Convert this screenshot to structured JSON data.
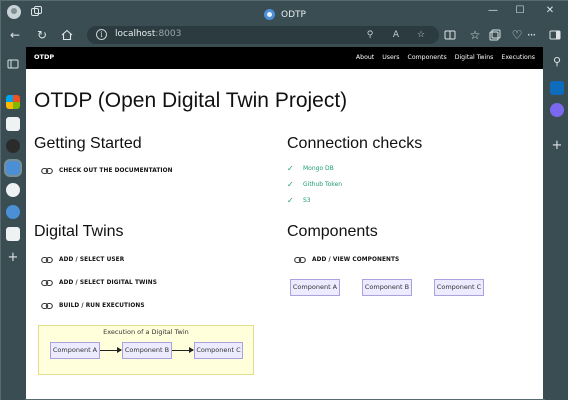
{
  "window": {
    "title": "ODTP",
    "controls": {
      "minimize": "—",
      "maximize": "☐",
      "close": "✕"
    }
  },
  "address_bar": {
    "host": "localhost",
    "port": ":8003"
  },
  "browser_icons": {
    "back": "back-arrow-icon",
    "refresh": "refresh-icon",
    "home": "home-icon",
    "zoom": "zoom-icon",
    "read_aloud": "read-aloud-icon",
    "favorite": "star-icon",
    "split": "split-screen-icon",
    "favorites": "favorites-icon",
    "collections": "collections-icon",
    "extensions": "extensions-icon",
    "more": "···",
    "sidebar": "sidebar-icon"
  },
  "site": {
    "brand": "OTDP",
    "nav": [
      "About",
      "Users",
      "Components",
      "Digital Twins",
      "Executions"
    ],
    "title": "OTDP (Open Digital Twin Project)"
  },
  "getting_started": {
    "heading": "Getting Started",
    "links": [
      "CHECK OUT THE DOCUMENTATION"
    ]
  },
  "connection_checks": {
    "heading": "Connection checks",
    "items": [
      "Mongo DB",
      "Github Token",
      "S3"
    ]
  },
  "digital_twins": {
    "heading": "Digital Twins",
    "links": [
      "ADD / SELECT USER",
      "ADD / SELECT DIGITAL TWINS",
      "BUILD / RUN EXECUTIONS"
    ],
    "diagram": {
      "title": "Execution of a Digital Twin",
      "nodes": [
        "Component A",
        "Component B",
        "Component C"
      ]
    }
  },
  "components": {
    "heading": "Components",
    "links": [
      "ADD / VIEW COMPONENTS"
    ],
    "items": [
      "Component A",
      "Component B",
      "Component C"
    ]
  },
  "colors": {
    "accent_green": "#1f9a78",
    "node_fill": "#ecebff",
    "node_border": "#a9a2e0",
    "diagram_bg": "#ffffdc",
    "chrome": "#3a4d53"
  }
}
